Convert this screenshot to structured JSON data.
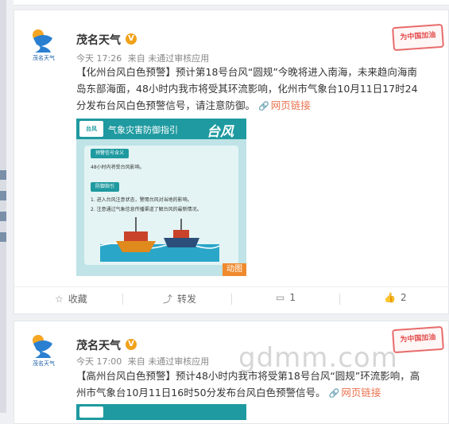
{
  "posts": [
    {
      "author": "茂名天气",
      "avatar_caption": "茂名天气",
      "time": "今天 17:26",
      "source": "来自 未通过审核应用",
      "stamp": "为中国加油",
      "headline": "【化州台风白色预警】",
      "body": "预计第18号台风“圆规”今晚将进入南海，未来趋向海南岛东部海面，48小时内我市将受其环流影响，化州市气象台10月11日17时24分发布台风白色预警信号，请注意防御。",
      "link_text": "网页链接",
      "poster": {
        "logo_text": "台风",
        "guide_title": "气象灾害防御指引",
        "big_title": "台风",
        "section1": "预警信号含义",
        "line1": "48小时内将受台风影响。",
        "section2": "防御指引",
        "line2": "1. 进入台风注意状态，警惕台风对当地的影响。",
        "line3": "2. 注意通过气象信息传播渠道了解台风的最新情况。",
        "badge": "动图"
      },
      "actions": {
        "favorite": "收藏",
        "repost": "转发",
        "comment_count": "1",
        "like_count": "2"
      }
    },
    {
      "author": "茂名天气",
      "avatar_caption": "茂名天气",
      "time": "今天 17:00",
      "source": "来自 未通过审核应用",
      "stamp": "为中国加油",
      "headline": "【高州台风白色预警】",
      "body": "预计48小时内我市将受第18号台风“圆规”环流影响，高州市气象台10月11日16时50分发布台风白色预警信号。",
      "link_text": "网页链接"
    }
  ],
  "watermark": "gdmm.com",
  "colors": {
    "link": "#eb7350",
    "verified": "#f0a21a",
    "poster": "#1e9aa0"
  }
}
